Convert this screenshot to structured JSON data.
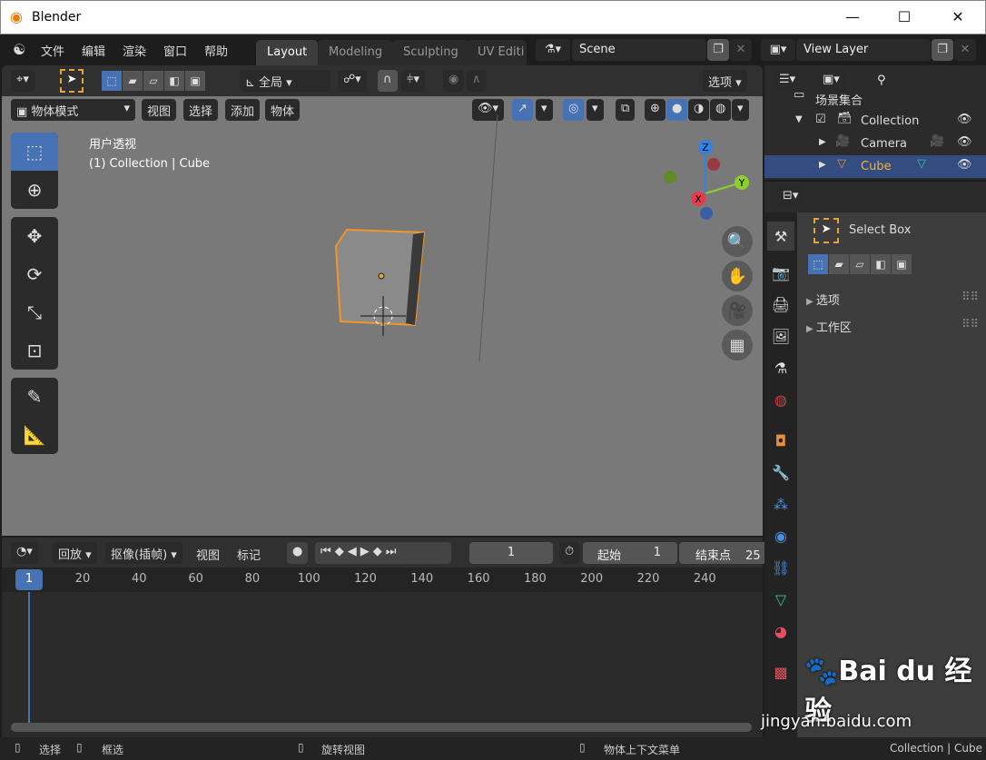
{
  "window": {
    "title": "Blender",
    "minimize": "—",
    "maximize": "☐",
    "close": "✕"
  },
  "menu": [
    "文件",
    "编辑",
    "渲染",
    "窗口",
    "帮助"
  ],
  "workspaces": [
    {
      "label": "Layout",
      "active": true
    },
    {
      "label": "Modeling"
    },
    {
      "label": "Sculpting"
    },
    {
      "label": "UV Editi"
    }
  ],
  "scene": {
    "name": "Scene",
    "view_layer": "View Layer"
  },
  "tool_header": {
    "orientation": "全局",
    "options": "选项"
  },
  "viewport_header": {
    "mode": "物体模式",
    "menus": [
      "视图",
      "选择",
      "添加",
      "物体"
    ]
  },
  "viewport": {
    "view_name": "用户透视",
    "context": "(1) Collection | Cube",
    "axes": {
      "x": "X",
      "y": "Y",
      "z": "Z"
    }
  },
  "outliner": {
    "root": "场景集合",
    "items": [
      {
        "name": "Collection",
        "type": "collection"
      },
      {
        "name": "Camera",
        "type": "camera"
      },
      {
        "name": "Cube",
        "type": "mesh",
        "selected": true
      }
    ]
  },
  "properties": {
    "tool_name": "Select Box",
    "panels": [
      "选项",
      "工作区"
    ]
  },
  "timeline": {
    "menus": [
      "回放",
      "抠像(插帧)",
      "视图",
      "标记"
    ],
    "current_frame": "1",
    "start_label": "起始",
    "start": "1",
    "end_label": "结束点",
    "end": "25",
    "ruler": [
      "20",
      "40",
      "60",
      "80",
      "100",
      "120",
      "140",
      "160",
      "180",
      "200",
      "220",
      "240"
    ]
  },
  "status": {
    "left_click": "选择",
    "drag": "框选",
    "middle": "旋转视图",
    "right": "物体上下文菜单",
    "info": "Collection | Cube"
  },
  "watermark": {
    "brand": "Bai du 经验",
    "url": "jingyan.baidu.com"
  },
  "colors": {
    "accent": "#4772b3",
    "selected_text": "#ffaf29",
    "viewport": "#797979"
  }
}
